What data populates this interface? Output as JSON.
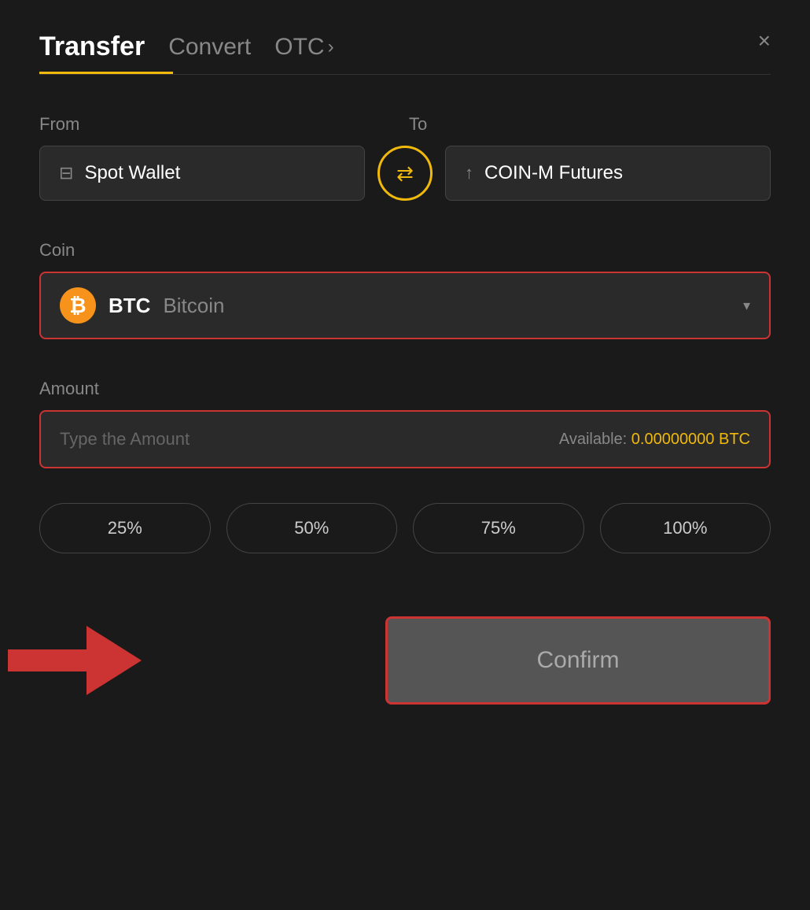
{
  "header": {
    "tab_transfer": "Transfer",
    "tab_convert": "Convert",
    "tab_otc": "OTC",
    "otc_chevron": "›",
    "close_label": "×"
  },
  "from_section": {
    "label": "From",
    "wallet_name": "Spot Wallet"
  },
  "to_section": {
    "label": "To",
    "wallet_name": "COIN-M Futures"
  },
  "coin_section": {
    "label": "Coin",
    "coin_symbol": "BTC",
    "coin_fullname": "Bitcoin",
    "coin_icon_letter": "₿"
  },
  "amount_section": {
    "label": "Amount",
    "placeholder": "Type the Amount",
    "available_label": "Available:",
    "available_value": "0.00000000 BTC"
  },
  "percent_buttons": [
    {
      "label": "25%"
    },
    {
      "label": "50%"
    },
    {
      "label": "75%"
    },
    {
      "label": "100%"
    }
  ],
  "confirm_button": {
    "label": "Confirm"
  }
}
